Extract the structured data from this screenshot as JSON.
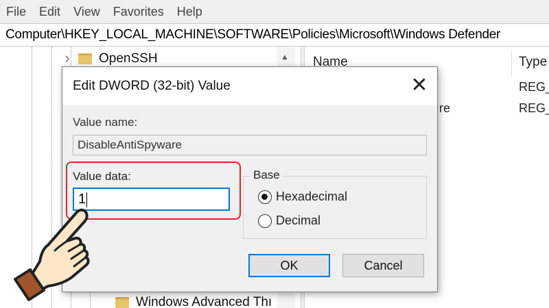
{
  "menubar": {
    "items": [
      "File",
      "Edit",
      "View",
      "Favorites",
      "Help"
    ]
  },
  "address": {
    "path": "Computer\\HKEY_LOCAL_MACHINE\\SOFTWARE\\Policies\\Microsoft\\Windows Defender"
  },
  "tree": {
    "top_item": "OpenSSH",
    "bottom_item": "Windows Advanced Thı"
  },
  "values": {
    "headers": {
      "name": "Name",
      "type": "Type"
    },
    "rows": [
      {
        "name": "",
        "type": "REG_"
      },
      {
        "name": "re",
        "type": "REG_"
      }
    ]
  },
  "dialog": {
    "title": "Edit DWORD (32-bit) Value",
    "close_glyph": "✕",
    "value_name_label": "Value name:",
    "value_name": "DisableAntiSpyware",
    "value_data_label": "Value data:",
    "value_data": "1",
    "base_label": "Base",
    "base_options": [
      "Hexadecimal",
      "Decimal"
    ],
    "base_selected": "Hexadecimal",
    "ok_label": "OK",
    "cancel_label": "Cancel"
  },
  "colors": {
    "highlight": "#d9262b",
    "focus": "#0078d7",
    "folder": "#e8c56c"
  },
  "icons": {
    "pointer": "hand-pointer-icon",
    "folder": "folder-icon",
    "chevron": "chevron-right-icon"
  }
}
